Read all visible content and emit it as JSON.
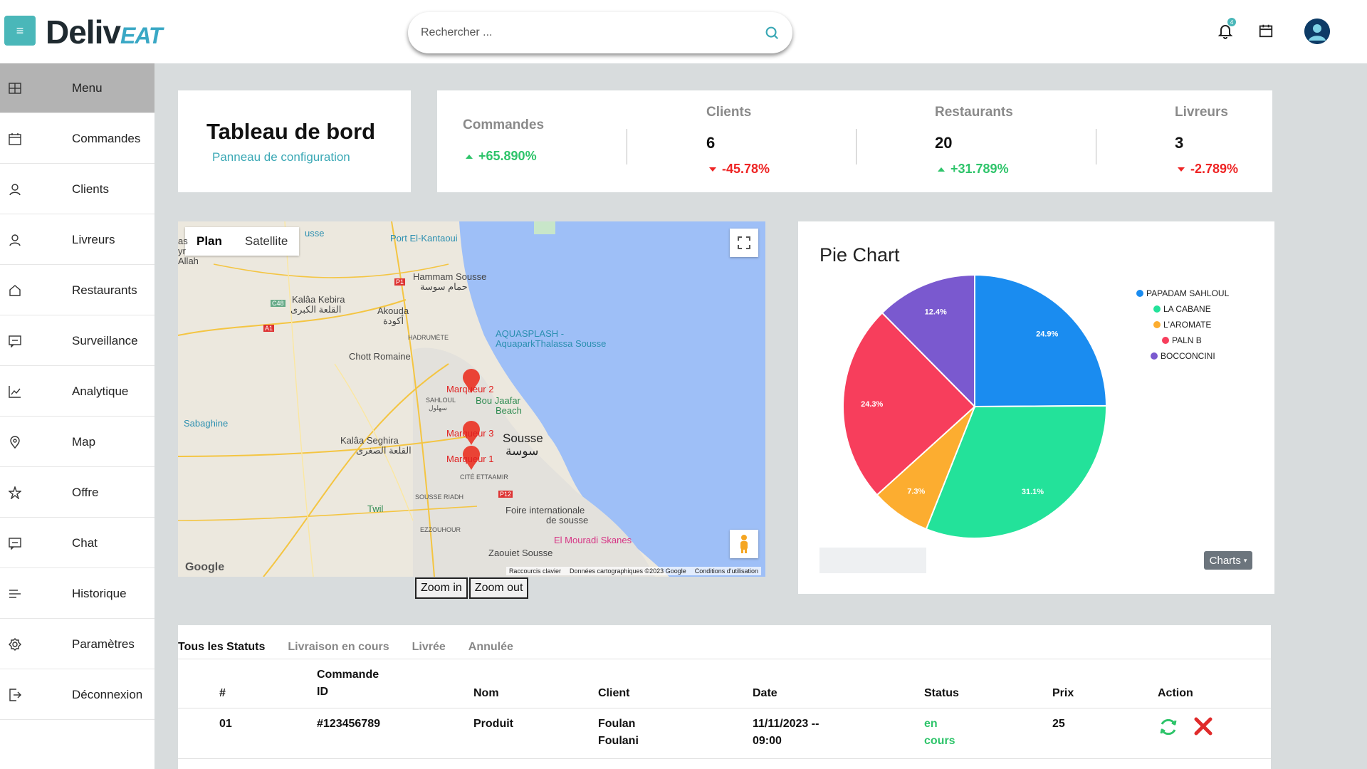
{
  "app": {
    "logo_main": "Deliv",
    "logo_accent": "EAT",
    "search_placeholder": "Rechercher ...",
    "notification_count": "4"
  },
  "sidebar": {
    "items": [
      {
        "label": "Menu",
        "icon": "grid-icon"
      },
      {
        "label": "Commandes",
        "icon": "calendar-icon"
      },
      {
        "label": "Clients",
        "icon": "user-icon"
      },
      {
        "label": "Livreurs",
        "icon": "user-icon"
      },
      {
        "label": "Restaurants",
        "icon": "home-icon"
      },
      {
        "label": "Surveillance",
        "icon": "message-icon"
      },
      {
        "label": "Analytique",
        "icon": "chart-line-icon"
      },
      {
        "label": "Map",
        "icon": "location-icon"
      },
      {
        "label": "Offre",
        "icon": "star-icon"
      },
      {
        "label": "Chat",
        "icon": "chat-icon"
      },
      {
        "label": "Historique",
        "icon": "list-icon"
      },
      {
        "label": "Paramètres",
        "icon": "gear-icon"
      },
      {
        "label": "Déconnexion",
        "icon": "logout-icon"
      }
    ]
  },
  "dashboard": {
    "title": "Tableau de bord",
    "subtitle": "Panneau de configuration"
  },
  "stats": {
    "commandes": {
      "label": "Commandes",
      "delta": "+65.890%"
    },
    "clients": {
      "label": "Clients",
      "value": "6",
      "delta": "-45.78%"
    },
    "restaurants": {
      "label": "Restaurants",
      "value": "20",
      "delta": "+31.789%"
    },
    "livreurs": {
      "label": "Livreurs",
      "value": "3",
      "delta": "-2.789%"
    }
  },
  "map": {
    "tab_plan": "Plan",
    "tab_satellite": "Satellite",
    "zoom_in": "Zoom in",
    "zoom_out": "Zoom out",
    "google": "Google",
    "footer_shortcuts": "Raccourcis clavier",
    "footer_data": "Données cartographiques ©2023 Google",
    "footer_terms": "Conditions d'utilisation",
    "markers": [
      "Marqueur 2",
      "Marqueur 3",
      "Marqueur 1"
    ],
    "places": {
      "port": "Port El-Kantaoui",
      "hammam": "Hammam Sousse",
      "hammam_ar": "حمام سوسة",
      "kalaa_kebira": "Kalâa Kebira",
      "kalaa_kebira_ar": "القلعة الكبرى",
      "akouda": "Akouda",
      "akouda_ar": "أكودة",
      "hadrumete": "HADRUMÈTE",
      "chott": "Chott Romaine",
      "aquasplash": "AQUASPLASH -",
      "aquapark": "AquaparkThalassa Sousse",
      "sahloul": "SAHLOUL",
      "sahloul_ar": "سهلول",
      "bou_jaafar": "Bou Jaafar",
      "beach": "Beach",
      "sabaghine": "Sabaghine",
      "sousse": "Sousse",
      "sousse_ar": "سوسة",
      "kalaa_seghira": "Kalâa Seghira",
      "kalaa_seghira_ar": "القلعة الصغرى",
      "cite_ettaamir": "CITÉ ETTAAMIR",
      "sousse_riadh": "SOUSSE RIADH",
      "twil": "Twil",
      "ezzouhour": "EZZOUHOUR",
      "foire": "Foire internationale",
      "de_sousse": "de sousse",
      "el_mouradi": "El Mouradi Skanes",
      "zaouiet": "Zaouiet Sousse",
      "road_p1": "P1",
      "road_c48": "C48",
      "road_a1": "A1",
      "road_p12": "P12",
      "partial_top": "usse",
      "partial_left": "as",
      "partial_left2": "yr",
      "partial_left3": "Allah"
    }
  },
  "pie": {
    "title": "Pie Chart",
    "button": "Charts"
  },
  "chart_data": {
    "type": "pie",
    "title": "Pie Chart",
    "labels": [
      "PAPADAM SAHLOUL",
      "LA CABANE",
      "L'AROMATE",
      "PALN B",
      "BOCCONCINI"
    ],
    "values": [
      24.9,
      31.1,
      7.3,
      24.3,
      12.4
    ],
    "value_labels": [
      "24.9%",
      "31.1%",
      "7.3%",
      "24.3%",
      "12.4%"
    ],
    "colors": [
      "#1a8cf0",
      "#23e29a",
      "#fcad30",
      "#f73e5c",
      "#7a59cf"
    ],
    "legend": "top-right"
  },
  "orders": {
    "tabs": [
      "Tous les Statuts",
      "Livraison en cours",
      "Livrée",
      "Annulée"
    ],
    "headers": {
      "num": "#",
      "command_id_1": "Commande",
      "command_id_2": "ID",
      "nom": "Nom",
      "client": "Client",
      "date": "Date",
      "status": "Status",
      "prix": "Prix",
      "action": "Action"
    },
    "rows": [
      {
        "num": "01",
        "id": "#123456789",
        "nom": "Produit",
        "client_1": "Foulan",
        "client_2": "Foulani",
        "date_1": "11/11/2023 --",
        "date_2": "09:00",
        "status_1": "en",
        "status_2": "cours",
        "prix": "25"
      }
    ]
  }
}
